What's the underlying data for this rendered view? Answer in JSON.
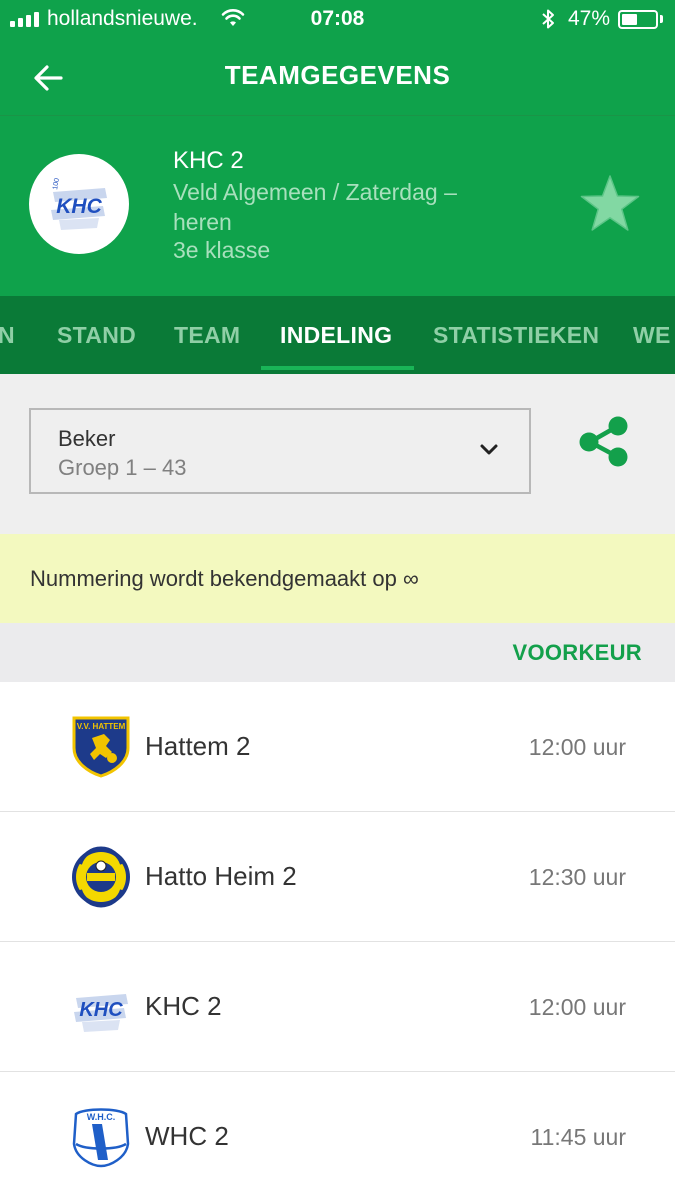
{
  "status_bar": {
    "carrier": "hollandsnieuwe.",
    "time": "07:08",
    "battery_percent": "47%",
    "battery_level": 0.47,
    "icons": [
      "signal-icon",
      "wifi-icon",
      "bluetooth-icon",
      "battery-icon"
    ]
  },
  "nav": {
    "title": "TEAMGEGEVENS",
    "back_icon": "arrow-left-icon"
  },
  "team": {
    "name": "KHC 2",
    "competition": "Veld Algemeen / Zaterdag – heren",
    "class": "3e klasse",
    "logo_text": "KHC",
    "favorite_icon": "star-icon"
  },
  "tabs": [
    {
      "label": "N",
      "active": false
    },
    {
      "label": "STAND",
      "active": false
    },
    {
      "label": "TEAM",
      "active": false
    },
    {
      "label": "INDELING",
      "active": true
    },
    {
      "label": "STATISTIEKEN",
      "active": false
    },
    {
      "label": "WE",
      "active": false
    }
  ],
  "filter": {
    "title": "Beker",
    "subtitle": "Groep 1 – 43",
    "chevron_icon": "chevron-down-icon",
    "share_icon": "share-icon"
  },
  "notice": {
    "text": "Nummering wordt bekendgemaakt op ∞"
  },
  "section": {
    "action_label": "VOORKEUR"
  },
  "teams": [
    {
      "name": "Hattem 2",
      "time": "12:00 uur",
      "logo": "hattem-logo-icon"
    },
    {
      "name": "Hatto Heim 2",
      "time": "12:30 uur",
      "logo": "hatto-heim-logo-icon"
    },
    {
      "name": "KHC 2",
      "time": "12:00 uur",
      "logo": "khc-logo-icon"
    },
    {
      "name": "WHC 2",
      "time": "11:45 uur",
      "logo": "whc-logo-icon"
    }
  ],
  "colors": {
    "primary_green": "#0fa24b",
    "tab_bar_green": "#0a7a37",
    "accent_green": "#13a04b",
    "notice_yellow": "#f3f9bf"
  }
}
